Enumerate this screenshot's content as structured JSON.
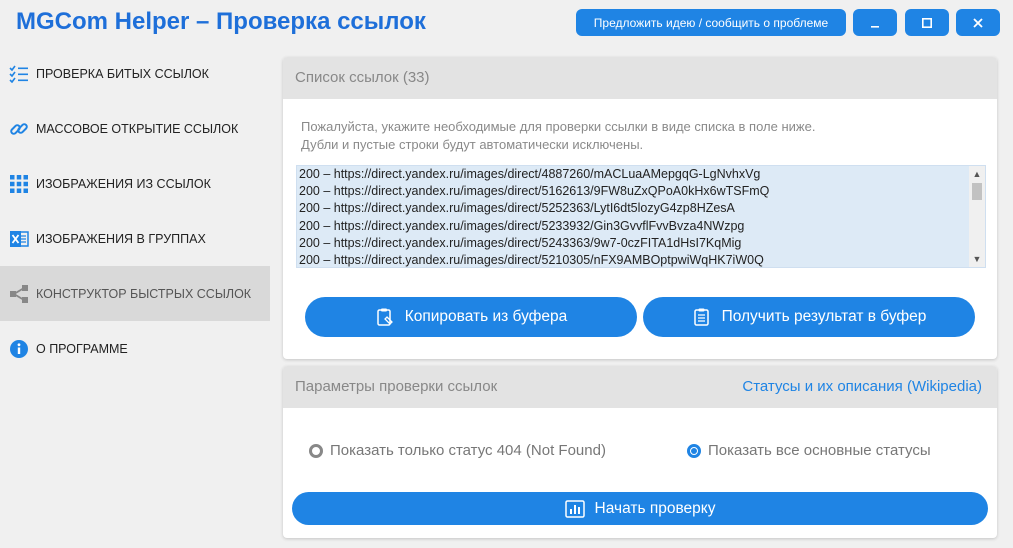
{
  "app": {
    "title": "MGCom Helper – Проверка ссылок",
    "feedback_label": "Предложить идею / сообщить о проблеме"
  },
  "colors": {
    "accent": "#1f84e4",
    "title": "#1e6fd9",
    "sidebar_active": "#d9d9d9"
  },
  "sidebar": {
    "items": [
      {
        "label": "Проверка битых ссылок",
        "icon": "checklist-icon",
        "active": false
      },
      {
        "label": "Массовое открытие ссылок",
        "icon": "link-icon",
        "active": false
      },
      {
        "label": "Изображения из ссылок",
        "icon": "grid-icon",
        "active": false
      },
      {
        "label": "Изображения в группах",
        "icon": "excel-icon",
        "active": false
      },
      {
        "label": "Конструктор быстрых ссылок",
        "icon": "share-icon",
        "active": true
      },
      {
        "label": "О программе",
        "icon": "info-icon",
        "active": false
      }
    ]
  },
  "links_panel": {
    "title": "Список ссылок (33)",
    "hint_line1": "Пожалуйста, укажите необходимые для проверки ссылки в виде списка в поле ниже.",
    "hint_line2": "Дубли и пустые строки будут автоматически исключены.",
    "rows": [
      "200 – https://direct.yandex.ru/images/direct/4887260/mACLuaAMepgqG-LgNvhxVg",
      "200 – https://direct.yandex.ru/images/direct/5162613/9FW8uZxQPoA0kHx6wTSFmQ",
      "200 – https://direct.yandex.ru/images/direct/5252363/LytI6dt5lozyG4zp8HZesA",
      "200 – https://direct.yandex.ru/images/direct/5233932/Gin3GvvflFvvBvza4NWzpg",
      "200 – https://direct.yandex.ru/images/direct/5243363/9w7-0czFITA1dHsI7KqMig",
      "200 – https://direct.yandex.ru/images/direct/5210305/nFX9AMBOptpwiWqHK7iW0Q"
    ],
    "copy_label": "Копировать из буфера",
    "result_label": "Получить результат в буфер"
  },
  "params_panel": {
    "title": "Параметры проверки ссылок",
    "wiki_link": "Статусы и их описания (Wikipedia)",
    "radio_404": "Показать только статус 404 (Not Found)",
    "radio_all": "Показать все основные статусы",
    "selected": "all",
    "start_label": "Начать проверку"
  }
}
